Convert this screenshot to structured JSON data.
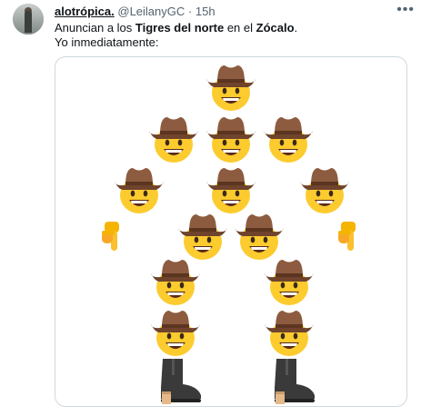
{
  "tweet": {
    "display_name": "alotrópica.",
    "handle": "@LeilanyGC",
    "separator": "·",
    "time": "15h",
    "more_icon": "more-dots-icon",
    "text_parts": [
      "Anuncian a los ",
      "Tigres del norte",
      " en el ",
      "Zócalo",
      "."
    ],
    "text_line2": "Yo inmediatamente:"
  },
  "media": {
    "emoji": {
      "cowboy": "cowboy-face-emoji",
      "pointing_down": "pointing-down-emoji",
      "boot": "boot-emoji"
    }
  },
  "colors": {
    "text": "#0f1419",
    "secondary": "#536471",
    "border": "#cfd9de",
    "face": "#fccb2e",
    "hat": "#8d5b3f",
    "boot": "#3a3a3a"
  }
}
